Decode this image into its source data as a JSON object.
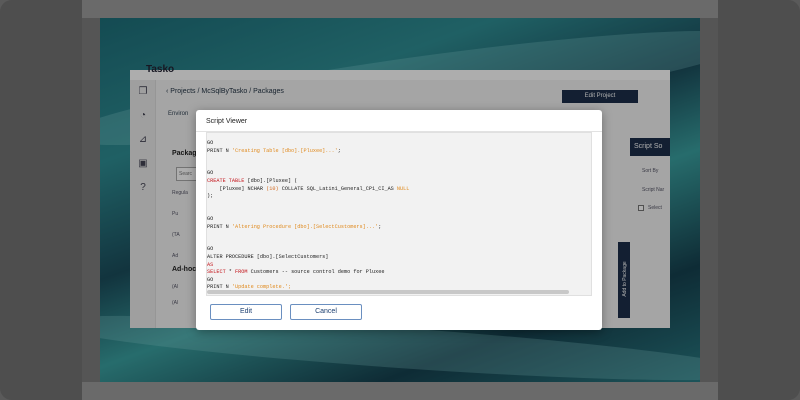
{
  "app": {
    "logo": "Tasko",
    "breadcrumb": "‹ Projects / McSqlByTasko / Packages",
    "edit_project": "Edit Project",
    "environment_label": "Environ",
    "packages_label": "Packag",
    "package_search_placeholder": "Searc",
    "package_rows": [
      "Regula",
      "Pu",
      "(TA",
      "Ad"
    ],
    "adhoc_label": "Ad-hoc",
    "adhoc_rows": [
      "(Al",
      "(Al"
    ],
    "script_button": "Script So",
    "sort_label": "Sort By",
    "script_name_label": "Script Nar",
    "select_label": "Select",
    "add_to_package": "Add to Package",
    "nav_icons": [
      "copy-icon",
      "dashboard-icon",
      "chart-icon",
      "database-icon",
      "help-icon"
    ]
  },
  "modal": {
    "title": "Script Viewer",
    "edit_label": "Edit",
    "cancel_label": "Cancel"
  },
  "script": {
    "lines": [
      [
        {
          "t": "GO",
          "c": ""
        }
      ],
      [
        {
          "t": "PRINT N ",
          "c": ""
        },
        {
          "t": "'Creating Table [dbo].[Pluxee]...'",
          "c": "str"
        },
        {
          "t": ";",
          "c": ""
        }
      ],
      [
        {
          "t": "",
          "c": ""
        }
      ],
      [
        {
          "t": "",
          "c": ""
        }
      ],
      [
        {
          "t": "GO",
          "c": ""
        }
      ],
      [
        {
          "t": "CREATE TABLE",
          "c": "kw"
        },
        {
          "t": " [dbo].[Pluxee] (",
          "c": ""
        }
      ],
      [
        {
          "t": "    [Pluxee] NCHAR ",
          "c": ""
        },
        {
          "t": "(10)",
          "c": "num"
        },
        {
          "t": " COLLATE SQL_Latin1_General_CP1_CI_AS ",
          "c": ""
        },
        {
          "t": "NULL",
          "c": "str"
        }
      ],
      [
        {
          "t": ");",
          "c": ""
        }
      ],
      [
        {
          "t": "",
          "c": ""
        }
      ],
      [
        {
          "t": "",
          "c": ""
        }
      ],
      [
        {
          "t": "GO",
          "c": ""
        }
      ],
      [
        {
          "t": "PRINT N ",
          "c": ""
        },
        {
          "t": "'Altering Procedure [dbo].[SelectCustomers]...'",
          "c": "str"
        },
        {
          "t": ";",
          "c": ""
        }
      ],
      [
        {
          "t": "",
          "c": ""
        }
      ],
      [
        {
          "t": "",
          "c": ""
        }
      ],
      [
        {
          "t": "GO",
          "c": ""
        }
      ],
      [
        {
          "t": "ALTER PROCEDURE [dbo].[SelectCustomers]",
          "c": ""
        }
      ],
      [
        {
          "t": "AS",
          "c": "kw"
        }
      ],
      [
        {
          "t": "SELECT",
          "c": "kw"
        },
        {
          "t": " * ",
          "c": ""
        },
        {
          "t": "FROM",
          "c": "kw"
        },
        {
          "t": " Customers -- source control demo for Pluxee",
          "c": ""
        }
      ],
      [
        {
          "t": "GO",
          "c": ""
        }
      ],
      [
        {
          "t": "PRINT N ",
          "c": ""
        },
        {
          "t": "'Update complete.';",
          "c": "str"
        }
      ]
    ]
  }
}
